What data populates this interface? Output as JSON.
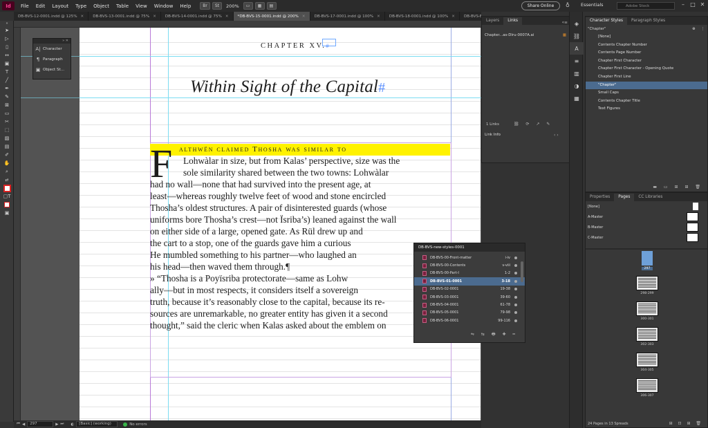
{
  "app": {
    "logo": "Id",
    "menus": [
      "File",
      "Edit",
      "Layout",
      "Type",
      "Object",
      "Table",
      "View",
      "Window",
      "Help"
    ],
    "bridge_label": "Br",
    "stock_label": "St",
    "zoom": "200%",
    "share_label": "Share Online",
    "workspace": "Essentials",
    "search_placeholder": "Adobe Stock"
  },
  "tabs": [
    {
      "label": "DB-BVS-12-0001.indd @ 125%",
      "active": false
    },
    {
      "label": "DB-BVS-13-0001.indd @ 75%",
      "active": false
    },
    {
      "label": "DB-BVS-14-0001.indd @ 75%",
      "active": false
    },
    {
      "label": "*DB-BVS-15-0001.indd @ 200%",
      "active": true
    },
    {
      "label": "DB-BVS-17-0001.indd @ 100%",
      "active": false
    },
    {
      "label": "DB-BVS-18-0001.indd @ 100%",
      "active": false
    },
    {
      "label": "DB-BVS-B...",
      "active": false
    }
  ],
  "mini_panel": {
    "items": [
      "Character",
      "Paragraph",
      "Object St..."
    ]
  },
  "document": {
    "chapter_label": "CHAPTER XV.",
    "chapter_mark": "#",
    "title": "Within Sight of the Capital",
    "title_mark": "#",
    "dropcap": "F",
    "opening_line": "althwën claimed Thosha was similar to",
    "body_lines": [
      "Lohwàlar in size, but from Kalas’ perspective, size was the",
      "sole similarity shared between the two towns: Lohwàlar",
      "had no wall—none that had survived into the present age, at",
      "least—whereas roughly twelve feet of wood and stone encircled",
      "Thosha’s oldest structures. A pair of disinterested guards (whose",
      "uniforms bore Thosha’s crest—not Ïsriba’s) leaned against the wall",
      "on either side of a large, opened gate. As Rül drew up and",
      "the cart to a stop, one of the guards gave him a curious",
      "He mumbled something to his partner—who laughed an",
      "his head—then waved them through.¶",
      "» “Thosha is a Poyïsriba protectorate—same as Lohw",
      "ally—but in most respects, it considers itself a sovereign",
      "truth, because it’s reasonably close to the capital, because its re-",
      "sources are unremarkable, no greater entity has given it a second",
      "thought,” said the cleric when Kalas asked about the emblem on"
    ]
  },
  "status": {
    "page": "297",
    "style": "[Basic] (working)",
    "errors": "No errors"
  },
  "links_panel": {
    "tabs": [
      "Layers",
      "Links"
    ],
    "active_tab": "Links",
    "file": "Chapter...as-Dlru-0007A.ai",
    "count": "1 Links",
    "info_label": "Link Info"
  },
  "char_styles_panel": {
    "tabs": [
      "Character Styles",
      "Paragraph Styles"
    ],
    "current": "\"Chapter\"",
    "items": [
      {
        "label": "[None]",
        "selected": false
      },
      {
        "label": "Contents Chapter Number",
        "selected": false
      },
      {
        "label": "Contents Page Number",
        "selected": false
      },
      {
        "label": "Chapter First Character",
        "selected": false
      },
      {
        "label": "Chapter First Character - Opening Quote",
        "selected": false
      },
      {
        "label": "Chapter First Line",
        "selected": false
      },
      {
        "label": "\"Chapter\"",
        "selected": true
      },
      {
        "label": "Small Caps",
        "selected": false
      },
      {
        "label": "Contents Chapter Title",
        "selected": false
      },
      {
        "label": "Text Figures",
        "selected": false
      }
    ]
  },
  "pages_panel": {
    "tabs": [
      "Properties",
      "Pages",
      "CC Libraries"
    ],
    "active_tab": "Pages",
    "masters": [
      "[None]",
      "A-Master",
      "B-Master",
      "C-Master"
    ],
    "current_page": "297",
    "spreads": [
      "298-299",
      "300-301",
      "302-303",
      "304-305",
      "306-307"
    ],
    "summary": "24 Pages in 13 Spreads"
  },
  "book_panel": {
    "title": "DB-BVS-new-styles-0001",
    "rows": [
      {
        "name": "DB-BVS-00-Front-matter",
        "pages": "i-iv",
        "selected": false
      },
      {
        "name": "DB-BVS-00-Contents",
        "pages": "v-viii",
        "selected": false
      },
      {
        "name": "DB-BVS-00-Part-I",
        "pages": "1-2",
        "selected": false
      },
      {
        "name": "DB-BVS-01-0001",
        "pages": "3-18",
        "selected": true
      },
      {
        "name": "DB-BVS-02-0001",
        "pages": "19-38",
        "selected": false
      },
      {
        "name": "DB-BVS-03-0001",
        "pages": "39-60",
        "selected": false
      },
      {
        "name": "DB-BVS-04-0001",
        "pages": "61-78",
        "selected": false
      },
      {
        "name": "DB-BVS-05-0001",
        "pages": "79-98",
        "selected": false
      },
      {
        "name": "DB-BVS-06-0001",
        "pages": "99-116",
        "selected": false
      }
    ]
  }
}
